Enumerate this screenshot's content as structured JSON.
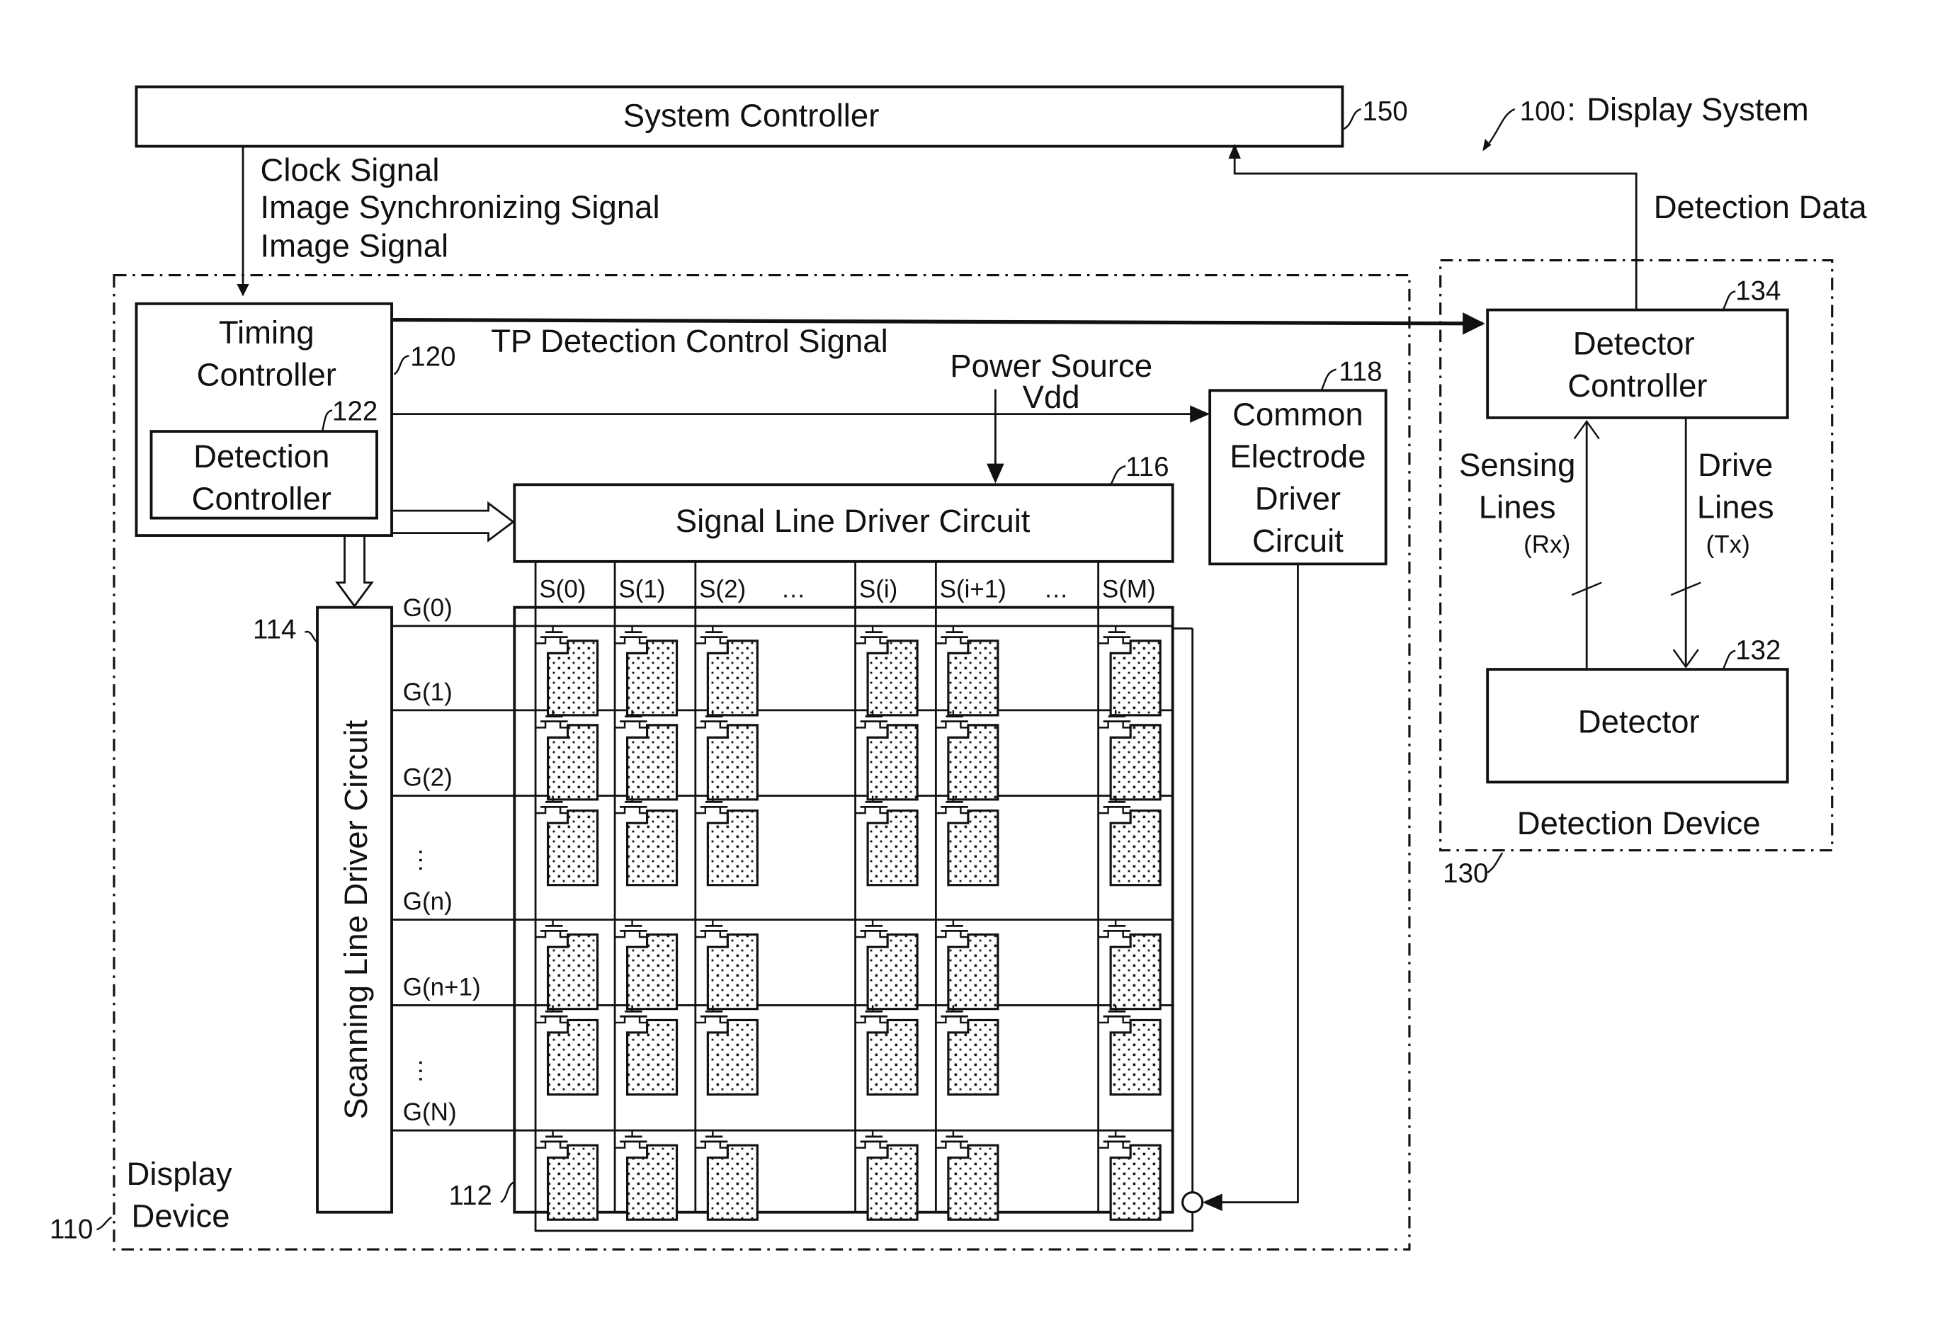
{
  "title": "100: Display System",
  "system_controller": {
    "label": "System Controller",
    "ref": "150"
  },
  "system_ref": {
    "ref": "100",
    "label": "Display System"
  },
  "signals_to_display": [
    "Clock Signal",
    "Image Synchronizing Signal",
    "Image Signal"
  ],
  "detection_data": "Detection Data",
  "tp_signal": "TP Detection Control Signal",
  "power_source": [
    "Power Source",
    "Vdd"
  ],
  "display_device": {
    "label": [
      "Display",
      "Device"
    ],
    "ref": "110",
    "timing_controller": {
      "label": [
        "Timing",
        "Controller"
      ],
      "ref": "120"
    },
    "detection_controller": {
      "label": [
        "Detection",
        "Controller"
      ],
      "ref": "122"
    },
    "signal_line_driver": {
      "label": "Signal Line Driver Circuit",
      "ref": "116"
    },
    "common_electrode_driver": {
      "label": [
        "Common",
        "Electrode",
        "Driver",
        "Circuit"
      ],
      "ref": "118"
    },
    "scanning_line_driver": {
      "label": "Scanning Line Driver Circuit",
      "ref": "114"
    },
    "pixel_array": {
      "ref": "112"
    },
    "source_lines": [
      "S(0)",
      "S(1)",
      "S(2)",
      "…",
      "S(i)",
      "S(i+1)",
      "…",
      "S(M)"
    ],
    "gate_lines": [
      "G(0)",
      "G(1)",
      "G(2)",
      "⋮",
      "G(n)",
      "G(n+1)",
      "⋮",
      "G(N)"
    ]
  },
  "detection_device": {
    "label": "Detection Device",
    "ref": "130",
    "detector_controller": {
      "label": [
        "Detector",
        "Controller"
      ],
      "ref": "134"
    },
    "detector": {
      "label": "Detector",
      "ref": "132"
    },
    "sensing_lines": [
      "Sensing",
      "Lines",
      "(Rx)"
    ],
    "drive_lines": [
      "Drive",
      "Lines",
      "(Tx)"
    ]
  }
}
